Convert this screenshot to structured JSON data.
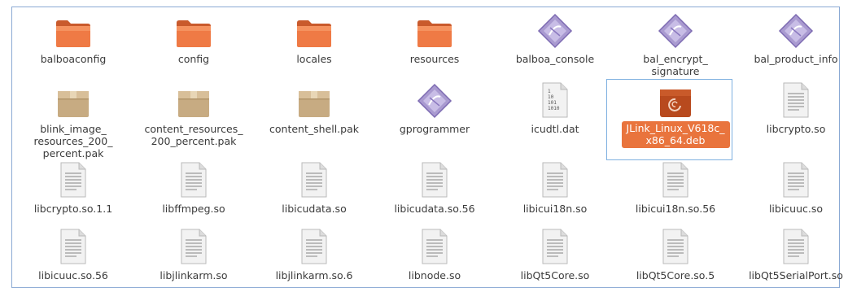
{
  "files": [
    {
      "name": "balboaconfig",
      "type": "folder"
    },
    {
      "name": "config",
      "type": "folder"
    },
    {
      "name": "locales",
      "type": "folder"
    },
    {
      "name": "resources",
      "type": "folder"
    },
    {
      "name": "balboa_console",
      "type": "exec"
    },
    {
      "name": "bal_encrypt_\nsignature",
      "type": "exec"
    },
    {
      "name": "bal_product_info",
      "type": "exec"
    },
    {
      "name": "blink_image_\nresources_200_\npercent.pak",
      "type": "package"
    },
    {
      "name": "content_resources_\n200_percent.pak",
      "type": "package"
    },
    {
      "name": "content_shell.pak",
      "type": "package"
    },
    {
      "name": "gprogrammer",
      "type": "exec"
    },
    {
      "name": "icudtl.dat",
      "type": "binary"
    },
    {
      "name": "JLink_Linux_V618c_\nx86_64.deb",
      "type": "deb",
      "selected": true
    },
    {
      "name": "libcrypto.so",
      "type": "doc"
    },
    {
      "name": "libcrypto.so.1.1",
      "type": "doc"
    },
    {
      "name": "libffmpeg.so",
      "type": "doc"
    },
    {
      "name": "libicudata.so",
      "type": "doc"
    },
    {
      "name": "libicudata.so.56",
      "type": "doc"
    },
    {
      "name": "libicui18n.so",
      "type": "doc"
    },
    {
      "name": "libicui18n.so.56",
      "type": "doc"
    },
    {
      "name": "libicuuc.so",
      "type": "doc"
    },
    {
      "name": "libicuuc.so.56",
      "type": "doc"
    },
    {
      "name": "libjlinkarm.so",
      "type": "doc"
    },
    {
      "name": "libjlinkarm.so.6",
      "type": "doc"
    },
    {
      "name": "libnode.so",
      "type": "doc"
    },
    {
      "name": "libQt5Core.so",
      "type": "doc"
    },
    {
      "name": "libQt5Core.so.5",
      "type": "doc"
    },
    {
      "name": "libQt5SerialPort.so",
      "type": "doc"
    }
  ],
  "binary_text": "1\n10\n101\n1010"
}
